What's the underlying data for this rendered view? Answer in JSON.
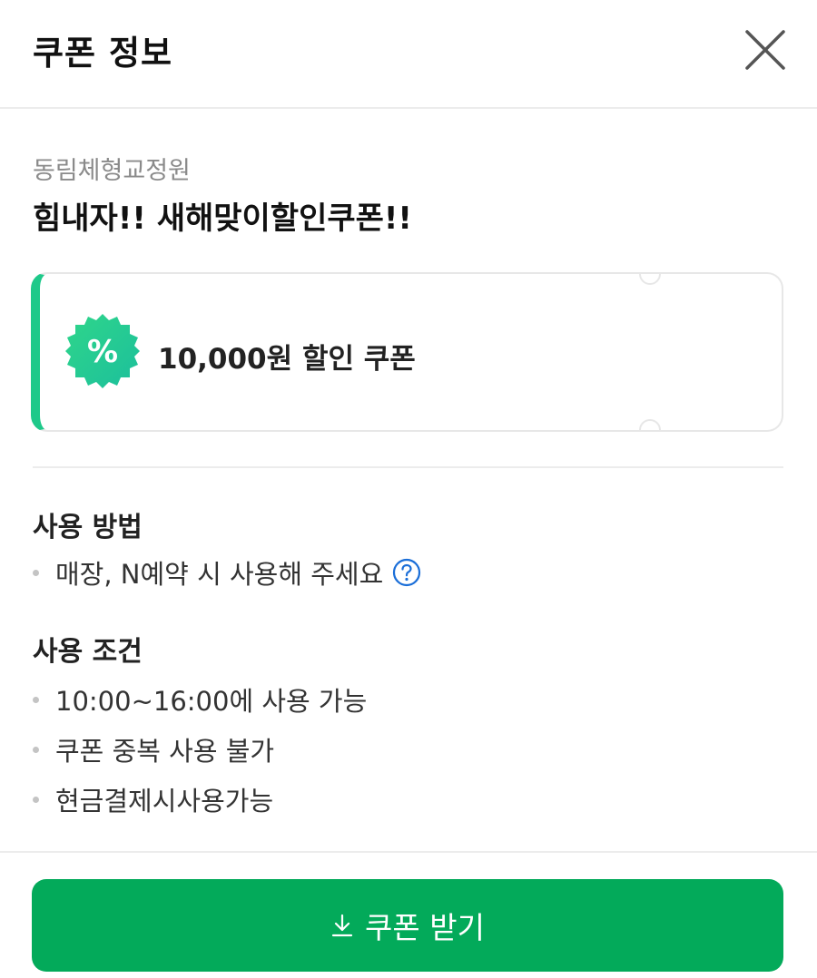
{
  "header": {
    "title": "쿠폰 정보"
  },
  "shop": {
    "name": "동림체형교정원"
  },
  "coupon": {
    "title": "힘내자!! 새해맞이할인쿠폰!!",
    "discount_label": "10,000원 할인 쿠폰",
    "badge_symbol": "%",
    "accent_color": "#1ec98a"
  },
  "usage_method": {
    "title": "사용 방법",
    "items": [
      "매장, N예약 시 사용해 주세요"
    ]
  },
  "usage_conditions": {
    "title": "사용 조건",
    "items": [
      "10:00~16:00에 사용 가능",
      "쿠폰 중복 사용 불가",
      "현금결제시사용가능"
    ]
  },
  "actions": {
    "download_label": "쿠폰 받기",
    "button_color": "#03aa5a"
  }
}
